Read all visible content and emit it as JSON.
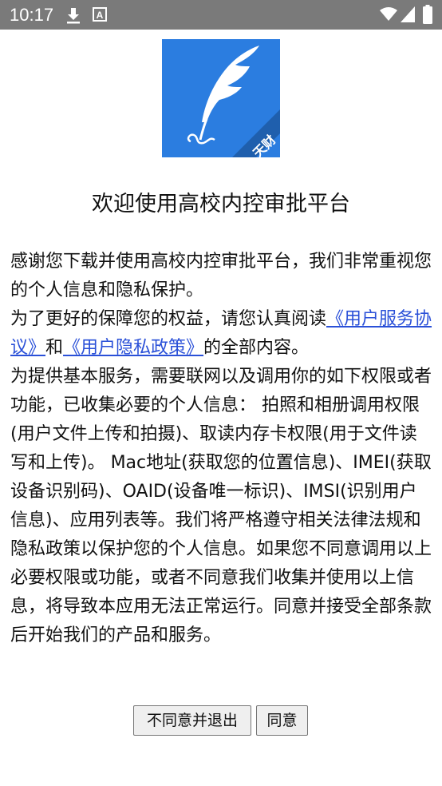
{
  "status_bar": {
    "time": "10:17",
    "icons": [
      "download-icon",
      "a-letter-icon",
      "wifi-icon",
      "signal-icon",
      "battery-icon"
    ],
    "a_glyph": "A"
  },
  "logo": {
    "badge_text": "天财",
    "colors": {
      "background": "#2b7de0",
      "feather": "#ffffff",
      "band": "#1f5fad"
    }
  },
  "dialog": {
    "title": "欢迎使用高校内控审批平台",
    "paragraphs": {
      "p1": "感谢您下载并使用高校内控审批平台，我们非常重视您的个人信息和隐私保护。",
      "p2_before": "为了更好的保障您的权益，请您认真阅读",
      "user_agreement_link": "《用户服务协议》",
      "p2_and": "和",
      "privacy_policy_link": "《用户隐私政策》",
      "p2_after": "的全部内容。",
      "p3": "为提供基本服务，需要联网以及调用你的如下权限或者功能，已收集必要的个人信息： 拍照和相册调用权限(用户文件上传和拍摄)、取读内存卡权限(用于文件读写和上传)。 Mac地址(获取您的位置信息)、IMEI(获取设备识别码)、OAID(设备唯一标识)、IMSI(识别用户信息)、应用列表等。我们将严格遵守相关法律法规和隐私政策以保护您的个人信息。如果您不同意调用以上必要权限或功能，或者不同意我们收集并使用以上信息，将导致本应用无法正常运行。同意并接受全部条款后开始我们的产品和服务。"
    },
    "buttons": {
      "disagree_label": "不同意并退出",
      "agree_label": "同意"
    }
  },
  "colors": {
    "status_bar": "#7a7a7a",
    "link": "#2a50d8",
    "button_bg": "#efefef"
  }
}
